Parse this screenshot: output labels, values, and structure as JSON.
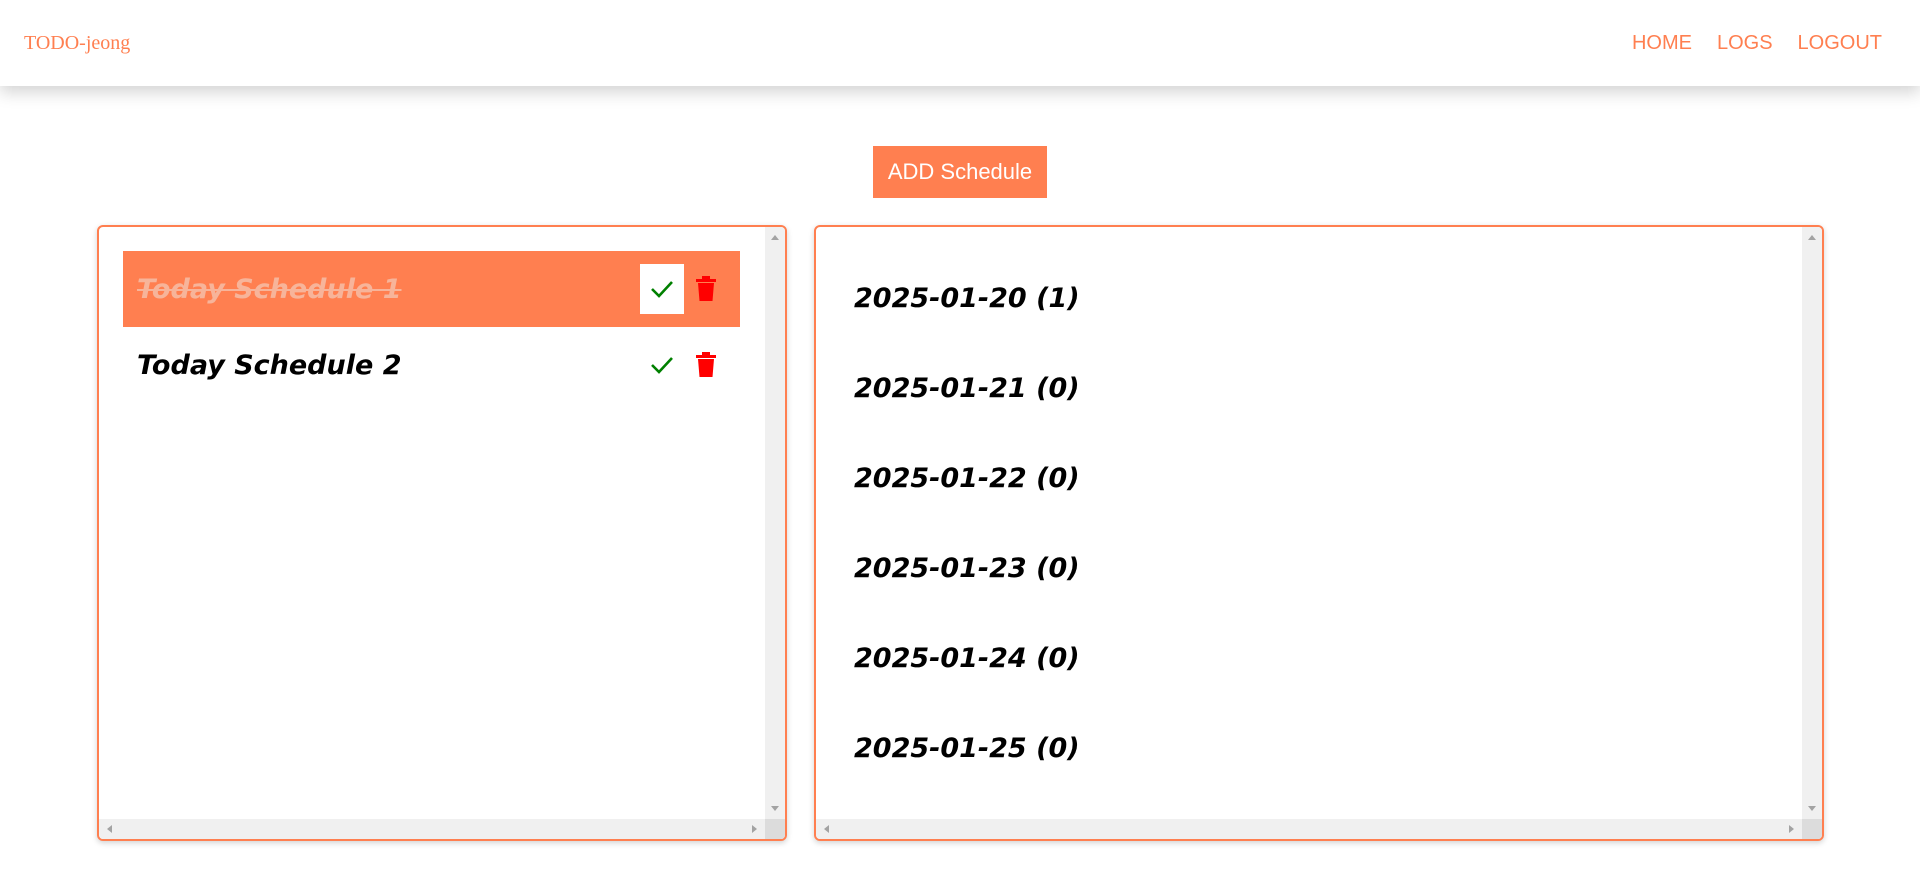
{
  "navbar": {
    "brand": "TODO-jeong",
    "links": [
      "HOME",
      "LOGS",
      "LOGOUT"
    ]
  },
  "toolbar": {
    "add_label": "ADD Schedule"
  },
  "schedules": [
    {
      "text": "Today Schedule 1",
      "done": true
    },
    {
      "text": "Today Schedule 2",
      "done": false
    }
  ],
  "logs": [
    "2025-01-20 (1)",
    "2025-01-21 (0)",
    "2025-01-22 (0)",
    "2025-01-23 (0)",
    "2025-01-24 (0)",
    "2025-01-25 (0)"
  ],
  "colors": {
    "accent": "#ff7f50",
    "check": "#008000",
    "delete": "#ff0000"
  },
  "icons": {
    "check": "check-icon",
    "delete": "trash-icon"
  }
}
